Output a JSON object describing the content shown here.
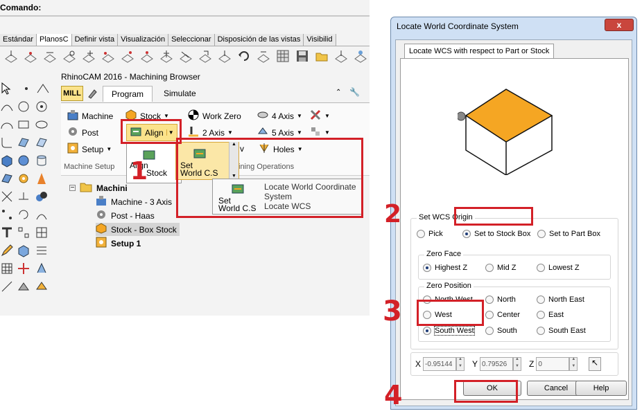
{
  "rhino": {
    "command_label": "Comando:",
    "toolbar_tabs": [
      "Estándar",
      "PlanosC",
      "Definir vista",
      "Visualización",
      "Seleccionar",
      "Disposición de las vistas",
      "Visibilid"
    ],
    "active_toolbar_tab": "PlanosC",
    "browser_title": "RhinoCAM 2016 - Machining Browser",
    "mode_badge": "MILL",
    "ribbon_tabs": {
      "program": "Program",
      "simulate": "Simulate"
    },
    "ribbon": {
      "machine": "Machine",
      "post": "Post",
      "setup": "Setup",
      "machine_setup_group": "Machine Setup",
      "stock": "Stock",
      "align": "Align",
      "work_zero": "Work Zero",
      "two_axis": "2 Axis",
      "four_axis": "4 Axis",
      "five_axis": "5 Axis",
      "holes": "Holes",
      "machining_ops_group": "ining Operations"
    },
    "align_menu": {
      "align_stock_line1": "Align",
      "align_stock_line2": "Stock",
      "set_wcs_line1": "Set",
      "set_wcs_line2": "World C.S",
      "v_label": "v"
    },
    "tooltip": {
      "icon_line1": "Set",
      "icon_line2": "World C.S",
      "title_line1": "Locate World Coordinate",
      "title_line2": "System",
      "subtitle": "Locate WCS"
    },
    "tree": {
      "root": "Machini",
      "items": [
        "Machine - 3 Axis",
        "Post - Haas",
        "Stock - Box Stock",
        "Setup 1"
      ]
    }
  },
  "dialog": {
    "title": "Locate World Coordinate System",
    "close_label": "x",
    "tab": "Locate WCS with respect to Part or Stock",
    "wcs_origin": {
      "label": "Set WCS Origin",
      "options": [
        "Pick",
        "Set to Stock Box",
        "Set to Part Box"
      ],
      "selected": "Set to Stock Box"
    },
    "zero_face": {
      "label": "Zero Face",
      "options": [
        "Highest Z",
        "Mid Z",
        "Lowest Z"
      ],
      "selected": "Highest Z"
    },
    "zero_position": {
      "label": "Zero Position",
      "options": [
        "North West",
        "North",
        "North East",
        "West",
        "Center",
        "East",
        "South West",
        "South",
        "South East"
      ],
      "selected": "South West"
    },
    "coords": {
      "x_label": "X",
      "x_value": "-0.95144",
      "y_label": "Y",
      "y_value": "0.79526",
      "z_label": "Z",
      "z_value": "0"
    },
    "buttons": {
      "ok": "OK",
      "cancel": "Cancel",
      "help": "Help"
    }
  },
  "annotations": {
    "step1": "1",
    "step2": "2",
    "step3": "3",
    "step4": "4",
    "color": "#d32027"
  },
  "colors": {
    "stock_top": "#f5a623",
    "selection": "#d5d5d5",
    "popup_highlight": "#fbe7a7"
  }
}
